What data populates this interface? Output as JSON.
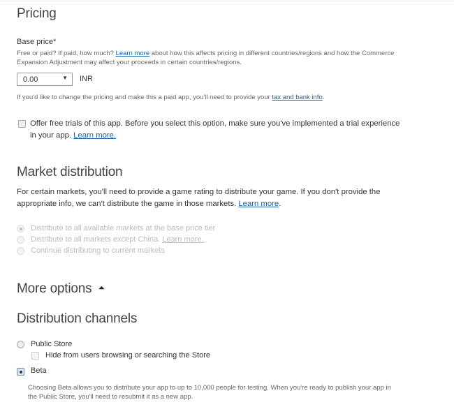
{
  "pricing": {
    "title": "Pricing",
    "base_price_label": "Base price*",
    "desc_pre": "Free or paid? If paid, how much? ",
    "desc_link": "Learn more",
    "desc_post": " about how this affects pricing in different countries/regions and how the Commerce",
    "desc_line2": "Expansion Adjustment may affect your proceeds in certain countries/regions.",
    "price_value": "0.00",
    "currency": "INR",
    "tax_pre": "If you'd like to change the pricing and make this a paid app, you'll need to provide your ",
    "tax_link": "tax and bank info",
    "tax_post": ".",
    "trial_line1": "Offer free trials of this app. Before you select this option, make sure you've implemented a trial experience",
    "trial_line2_pre": "in your app. ",
    "trial_link": "Learn more."
  },
  "market": {
    "title": "Market distribution",
    "para_line1": "For certain markets, you'll need to provide a game rating to distribute your game. If you don't provide the",
    "para_line2_pre": "appropriate info, we can't distribute the game in those markets. ",
    "para_link": "Learn more",
    "para_post": ".",
    "options": [
      {
        "label": "Distribute to all available markets at the base price tier"
      },
      {
        "label": "Distribute to all markets except China. ",
        "link": "Learn more."
      },
      {
        "label": "Continue distributing to current markets"
      }
    ]
  },
  "more_options": {
    "title": "More options",
    "icon": "collapse-arrow-icon"
  },
  "channels": {
    "title": "Distribution channels",
    "public_store": "Public Store",
    "hide_label": "Hide from users browsing or searching the Store",
    "beta": "Beta",
    "beta_desc1": "Choosing Beta allows you to distribute your app to up to 10,000 people for testing. When you're ready to publish your app in",
    "beta_desc2": "the Public Store, you'll need to resubmit it as a new app."
  }
}
